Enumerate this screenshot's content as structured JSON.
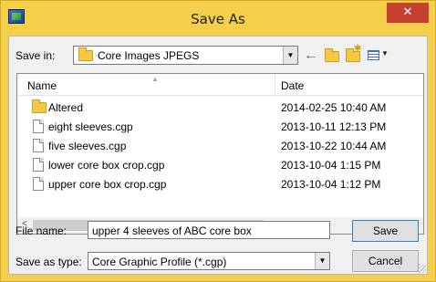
{
  "window": {
    "title": "Save As",
    "close_glyph": "✕"
  },
  "toolbar": {
    "save_in_label": "Save in:",
    "save_in_value": "Core Images JPEGS",
    "icons": [
      "back-arrow-icon",
      "up-folder-icon",
      "new-folder-icon",
      "view-menu-icon"
    ]
  },
  "list": {
    "columns": [
      "Name",
      "Date"
    ],
    "items": [
      {
        "name": "Altered",
        "date": "2014-02-25 10:40 AM",
        "kind": "folder"
      },
      {
        "name": "eight sleeves.cgp",
        "date": "2013-10-11 12:13 PM",
        "kind": "file"
      },
      {
        "name": "five sleeves.cgp",
        "date": "2013-10-22 10:44 AM",
        "kind": "file"
      },
      {
        "name": "lower core box crop.cgp",
        "date": "2013-10-04 1:15 PM",
        "kind": "file"
      },
      {
        "name": "upper core box crop.cgp",
        "date": "2013-10-04 1:12 PM",
        "kind": "file"
      }
    ]
  },
  "form": {
    "file_name_label": "File name:",
    "file_name_value": "upper 4 sleeves of ABC core box",
    "save_as_type_label": "Save as type:",
    "save_as_type_value": "Core Graphic Profile (*.cgp)"
  },
  "buttons": {
    "save": "Save",
    "cancel": "Cancel"
  },
  "colors": {
    "title_bar": "#f5cf4a",
    "close_button": "#c7402f",
    "client": "#f0f0f0"
  }
}
